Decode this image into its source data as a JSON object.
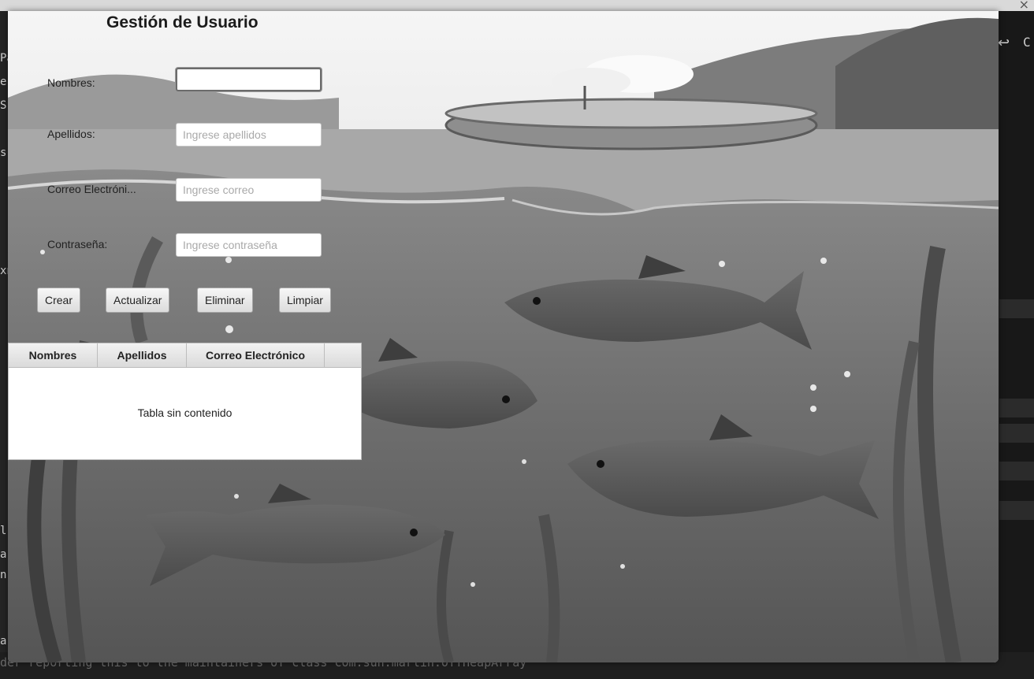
{
  "window": {
    "title": "Gestión de Usuario"
  },
  "form": {
    "nombres": {
      "label": "Nombres:",
      "value": "",
      "placeholder": ""
    },
    "apellidos": {
      "label": "Apellidos:",
      "value": "",
      "placeholder": "Ingrese apellidos"
    },
    "correo": {
      "label": "Correo Electróni...",
      "value": "",
      "placeholder": "Ingrese correo"
    },
    "contrasena": {
      "label": "Contraseña:",
      "value": "",
      "placeholder": "Ingrese contraseña"
    }
  },
  "buttons": {
    "crear": "Crear",
    "actualizar": "Actualizar",
    "eliminar": "Eliminar",
    "limpiar": "Limpiar"
  },
  "table": {
    "columns": [
      "Nombres",
      "Apellidos",
      "Correo Electrónico"
    ],
    "empty_text": "Tabla sin contenido"
  },
  "ide": {
    "left_fragments": [
      "Pa",
      "er",
      "S",
      "s",
      "xn",
      "l",
      "a",
      "n",
      "a"
    ],
    "bottom_text": "der reporting this to the maintainers of class com.sun.marlin.OffHeapArray",
    "right_fragment": "C",
    "close_glyph": "×"
  },
  "colors": {
    "button_bg": "#e6e6e6",
    "ide_bg": "#1f1f1f"
  }
}
